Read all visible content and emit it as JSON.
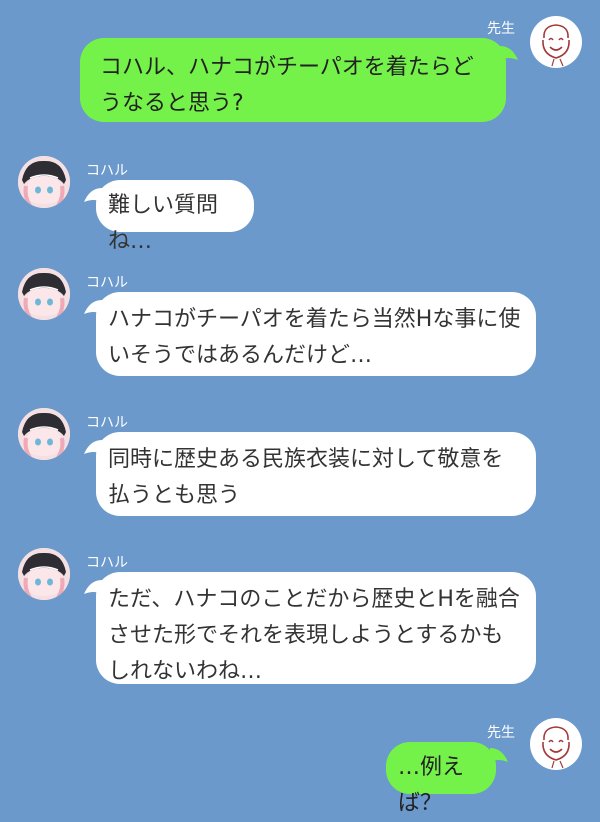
{
  "colors": {
    "background": "#6c99cb",
    "teacher_bubble": "#75f24a",
    "koharu_bubble": "#ffffff",
    "name_text": "#ffffff"
  },
  "messages": [
    {
      "speaker": "先生",
      "side": "right",
      "avatar": "smiling-face-avatar-icon",
      "text": "コハル、ハナコがチーパオを着たらどうなると思う?"
    },
    {
      "speaker": "コハル",
      "side": "left",
      "avatar": "koharu-avatar-icon",
      "text": "難しい質問ね…"
    },
    {
      "speaker": "コハル",
      "side": "left",
      "avatar": "koharu-avatar-icon",
      "text": "ハナコがチーパオを着たら当然Hな事に使いそうではあるんだけど…"
    },
    {
      "speaker": "コハル",
      "side": "left",
      "avatar": "koharu-avatar-icon",
      "text": "同時に歴史ある民族衣装に対して敬意を払うとも思う"
    },
    {
      "speaker": "コハル",
      "side": "left",
      "avatar": "koharu-avatar-icon",
      "text": "ただ、ハナコのことだから歴史とHを融合させた形でそれを表現しようとするかもしれないわね…"
    },
    {
      "speaker": "先生",
      "side": "right",
      "avatar": "smiling-face-avatar-icon",
      "text": "…例えば？"
    }
  ]
}
